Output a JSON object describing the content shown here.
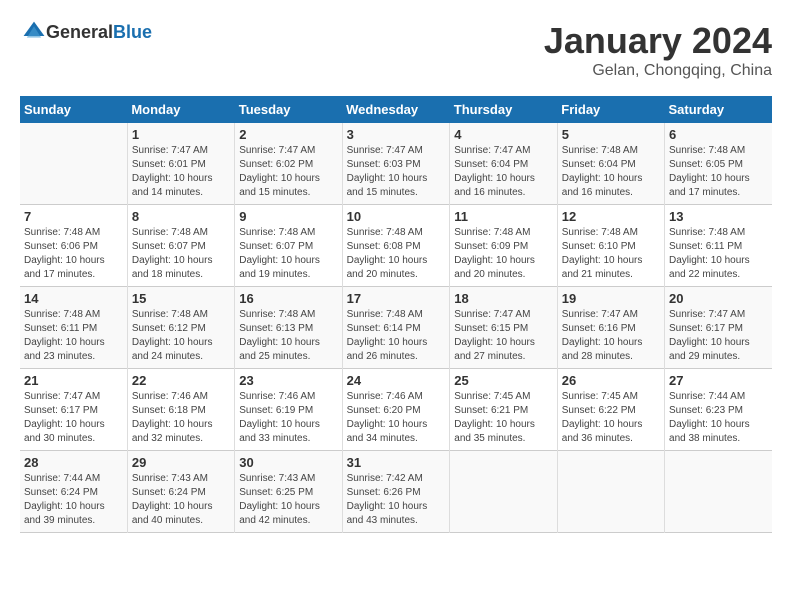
{
  "header": {
    "logo_general": "General",
    "logo_blue": "Blue",
    "title": "January 2024",
    "subtitle": "Gelan, Chongqing, China"
  },
  "calendar": {
    "days_of_week": [
      "Sunday",
      "Monday",
      "Tuesday",
      "Wednesday",
      "Thursday",
      "Friday",
      "Saturday"
    ],
    "weeks": [
      [
        {
          "day": "",
          "info": ""
        },
        {
          "day": "1",
          "info": "Sunrise: 7:47 AM\nSunset: 6:01 PM\nDaylight: 10 hours\nand 14 minutes."
        },
        {
          "day": "2",
          "info": "Sunrise: 7:47 AM\nSunset: 6:02 PM\nDaylight: 10 hours\nand 15 minutes."
        },
        {
          "day": "3",
          "info": "Sunrise: 7:47 AM\nSunset: 6:03 PM\nDaylight: 10 hours\nand 15 minutes."
        },
        {
          "day": "4",
          "info": "Sunrise: 7:47 AM\nSunset: 6:04 PM\nDaylight: 10 hours\nand 16 minutes."
        },
        {
          "day": "5",
          "info": "Sunrise: 7:48 AM\nSunset: 6:04 PM\nDaylight: 10 hours\nand 16 minutes."
        },
        {
          "day": "6",
          "info": "Sunrise: 7:48 AM\nSunset: 6:05 PM\nDaylight: 10 hours\nand 17 minutes."
        }
      ],
      [
        {
          "day": "7",
          "info": "Sunrise: 7:48 AM\nSunset: 6:06 PM\nDaylight: 10 hours\nand 17 minutes."
        },
        {
          "day": "8",
          "info": "Sunrise: 7:48 AM\nSunset: 6:07 PM\nDaylight: 10 hours\nand 18 minutes."
        },
        {
          "day": "9",
          "info": "Sunrise: 7:48 AM\nSunset: 6:07 PM\nDaylight: 10 hours\nand 19 minutes."
        },
        {
          "day": "10",
          "info": "Sunrise: 7:48 AM\nSunset: 6:08 PM\nDaylight: 10 hours\nand 20 minutes."
        },
        {
          "day": "11",
          "info": "Sunrise: 7:48 AM\nSunset: 6:09 PM\nDaylight: 10 hours\nand 20 minutes."
        },
        {
          "day": "12",
          "info": "Sunrise: 7:48 AM\nSunset: 6:10 PM\nDaylight: 10 hours\nand 21 minutes."
        },
        {
          "day": "13",
          "info": "Sunrise: 7:48 AM\nSunset: 6:11 PM\nDaylight: 10 hours\nand 22 minutes."
        }
      ],
      [
        {
          "day": "14",
          "info": "Sunrise: 7:48 AM\nSunset: 6:11 PM\nDaylight: 10 hours\nand 23 minutes."
        },
        {
          "day": "15",
          "info": "Sunrise: 7:48 AM\nSunset: 6:12 PM\nDaylight: 10 hours\nand 24 minutes."
        },
        {
          "day": "16",
          "info": "Sunrise: 7:48 AM\nSunset: 6:13 PM\nDaylight: 10 hours\nand 25 minutes."
        },
        {
          "day": "17",
          "info": "Sunrise: 7:48 AM\nSunset: 6:14 PM\nDaylight: 10 hours\nand 26 minutes."
        },
        {
          "day": "18",
          "info": "Sunrise: 7:47 AM\nSunset: 6:15 PM\nDaylight: 10 hours\nand 27 minutes."
        },
        {
          "day": "19",
          "info": "Sunrise: 7:47 AM\nSunset: 6:16 PM\nDaylight: 10 hours\nand 28 minutes."
        },
        {
          "day": "20",
          "info": "Sunrise: 7:47 AM\nSunset: 6:17 PM\nDaylight: 10 hours\nand 29 minutes."
        }
      ],
      [
        {
          "day": "21",
          "info": "Sunrise: 7:47 AM\nSunset: 6:17 PM\nDaylight: 10 hours\nand 30 minutes."
        },
        {
          "day": "22",
          "info": "Sunrise: 7:46 AM\nSunset: 6:18 PM\nDaylight: 10 hours\nand 32 minutes."
        },
        {
          "day": "23",
          "info": "Sunrise: 7:46 AM\nSunset: 6:19 PM\nDaylight: 10 hours\nand 33 minutes."
        },
        {
          "day": "24",
          "info": "Sunrise: 7:46 AM\nSunset: 6:20 PM\nDaylight: 10 hours\nand 34 minutes."
        },
        {
          "day": "25",
          "info": "Sunrise: 7:45 AM\nSunset: 6:21 PM\nDaylight: 10 hours\nand 35 minutes."
        },
        {
          "day": "26",
          "info": "Sunrise: 7:45 AM\nSunset: 6:22 PM\nDaylight: 10 hours\nand 36 minutes."
        },
        {
          "day": "27",
          "info": "Sunrise: 7:44 AM\nSunset: 6:23 PM\nDaylight: 10 hours\nand 38 minutes."
        }
      ],
      [
        {
          "day": "28",
          "info": "Sunrise: 7:44 AM\nSunset: 6:24 PM\nDaylight: 10 hours\nand 39 minutes."
        },
        {
          "day": "29",
          "info": "Sunrise: 7:43 AM\nSunset: 6:24 PM\nDaylight: 10 hours\nand 40 minutes."
        },
        {
          "day": "30",
          "info": "Sunrise: 7:43 AM\nSunset: 6:25 PM\nDaylight: 10 hours\nand 42 minutes."
        },
        {
          "day": "31",
          "info": "Sunrise: 7:42 AM\nSunset: 6:26 PM\nDaylight: 10 hours\nand 43 minutes."
        },
        {
          "day": "",
          "info": ""
        },
        {
          "day": "",
          "info": ""
        },
        {
          "day": "",
          "info": ""
        }
      ]
    ]
  }
}
